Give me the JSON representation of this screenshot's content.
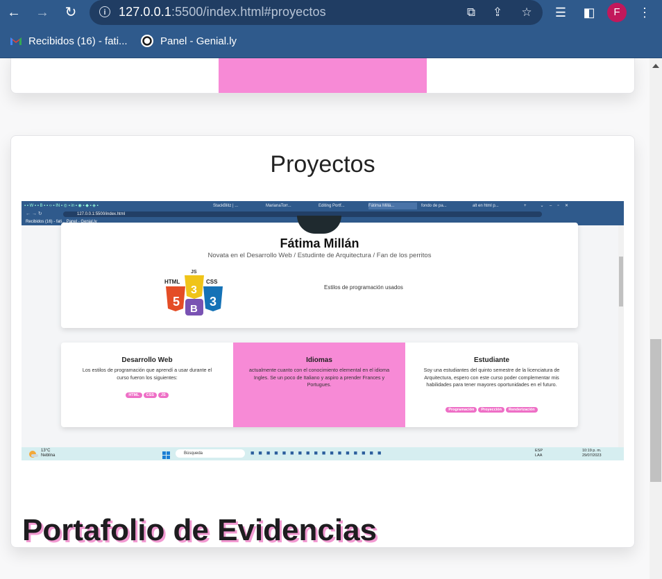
{
  "browser": {
    "url_host": "127.0.0.1",
    "url_rest": ":5500/index.html#proyectos",
    "avatar_letter": "F",
    "bookmarks": [
      {
        "label": "Recibidos (16) - fati..."
      },
      {
        "label": "Panel - Genial.ly"
      }
    ]
  },
  "page": {
    "projects_title": "Proyectos",
    "portfolio_title": "Portafolio de Evidencias"
  },
  "screenshot": {
    "tabs": [
      "StackBlitz | ...",
      "MarianaTorr...",
      "Editing Portf...",
      "Fátima Millá...",
      "fondo de pa...",
      "alt en html p..."
    ],
    "url": "127.0.0.1:5500/index.html",
    "bookmarks": "Recibidos (16) - fati...     Panel - Genial.ly",
    "profile_name": "Fátima Millán",
    "profile_subtitle": "Novata en el Desarrollo Web / Estudinte de Arquitectura / Fan de los perritos",
    "styles_label": "Estilos de programación usados",
    "logo_letters": {
      "html": "HTML",
      "css": "CSS",
      "js": "JS",
      "five": "5",
      "three": "3",
      "b": "B"
    },
    "columns": [
      {
        "title": "Desarrollo Web",
        "text": "Los estilos de programación que aprendí a usar durante el curso fueron los siguientes:",
        "tags": [
          "HTML",
          "CSS",
          "JS"
        ]
      },
      {
        "title": "Idiomas",
        "text": "actualmente cuanto con el conocimiento elemental en el idioma Ingles. Se un poco de Italiano y aspiro a prender Frances y Portugues.",
        "tags": []
      },
      {
        "title": "Estudiante",
        "text": "Soy una estudiantes del quinto semestre de la licenciatura de Arquitectura, espero con este curso poder complementar mis habilidades para tener mayores oportunidades en el futuro.",
        "tags": [
          "Programación",
          "Proyección",
          "Renderización"
        ]
      }
    ],
    "taskbar": {
      "weather_temp": "13°C",
      "weather_desc": "Neblina",
      "search": "Búsqueda",
      "lang": "ESP",
      "lang2": "LAA",
      "time": "10:19 p. m.",
      "date": "29/07/2023"
    }
  },
  "colors": {
    "accent_pink": "#f78ad6",
    "chrome_blue": "#2f5a8c"
  }
}
